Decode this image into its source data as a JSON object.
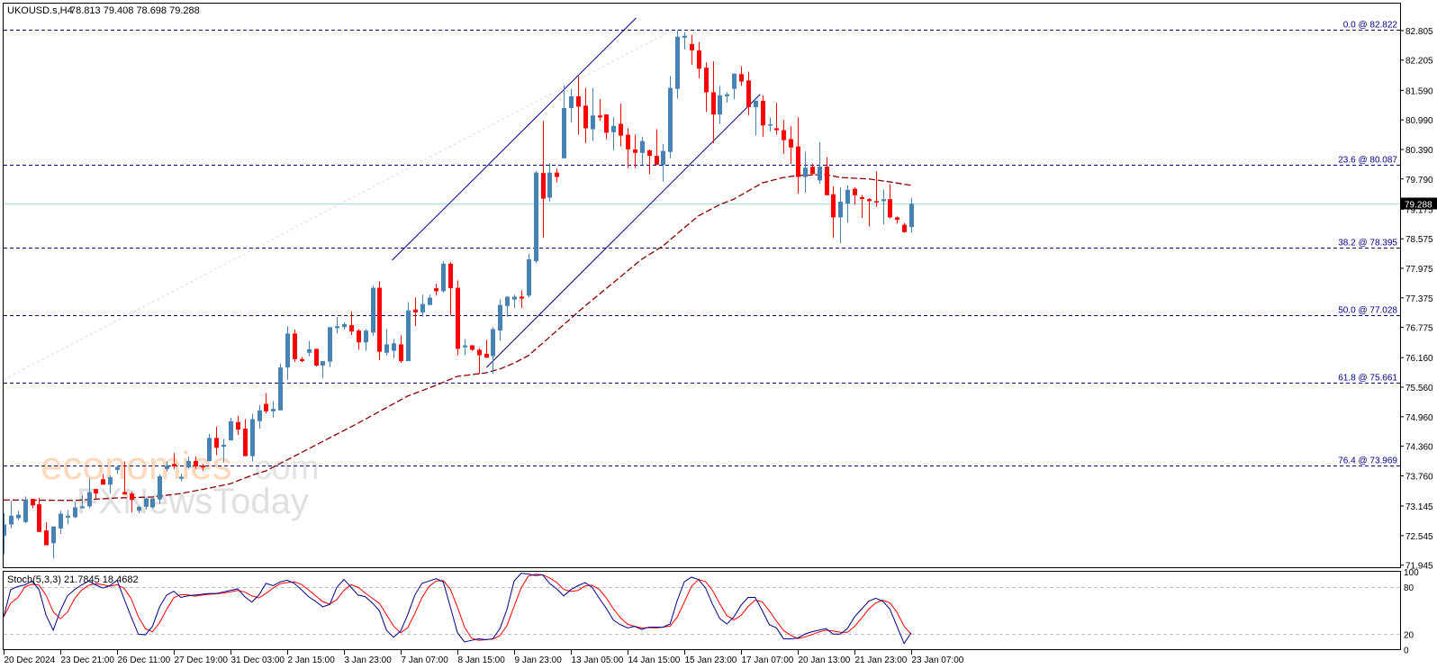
{
  "header": {
    "symbol": "UKOUSD.s,H4",
    "ohlc": "78.813 79.408 78.698 79.288"
  },
  "watermark": {
    "brand1": "economies",
    "brand1_suffix": ".com",
    "brand2": "FXNewsToday"
  },
  "colors": {
    "bull": "#4682b4",
    "bear": "#ff0000",
    "ma": "#8b0000",
    "fib": "#00008b",
    "trend": "#00008b",
    "price_line": "#9fe0e8",
    "stoch_k": "#00008b",
    "stoch_d": "#ff0000"
  },
  "chart_data": {
    "type": "candlestick",
    "title": "UKOUSD.s,H4",
    "ylim": [
      71.945,
      82.822
    ],
    "price_axis_ticks": [
      "82.805",
      "82.205",
      "81.590",
      "80.990",
      "80.390",
      "79.790",
      "79.175",
      "78.575",
      "77.975",
      "77.375",
      "76.775",
      "76.160",
      "75.560",
      "74.960",
      "74.360",
      "73.760",
      "73.145",
      "72.545",
      "71.945"
    ],
    "current_price": "79.288",
    "time_labels": [
      "20 Dec 2024",
      "23 Dec 21:00",
      "26 Dec 11:00",
      "27 Dec 19:00",
      "31 Dec 03:00",
      "2 Jan 15:00",
      "3 Jan 23:00",
      "7 Jan 07:00",
      "8 Jan 15:00",
      "9 Jan 23:00",
      "13 Jan 05:00",
      "14 Jan 15:00",
      "15 Jan 23:00",
      "17 Jan 07:00",
      "20 Jan 13:00",
      "21 Jan 23:00",
      "23 Jan 07:00"
    ],
    "bars_per_time_label": 8,
    "candles_ohlc": [
      [
        72.54,
        73.01,
        72.17,
        72.77
      ],
      [
        72.77,
        73.25,
        72.69,
        72.95
      ],
      [
        72.9,
        73.05,
        72.86,
        72.97
      ],
      [
        72.82,
        73.34,
        72.8,
        73.27
      ],
      [
        73.29,
        73.29,
        73.1,
        73.16
      ],
      [
        73.18,
        73.31,
        72.62,
        72.62
      ],
      [
        72.65,
        72.82,
        72.35,
        72.35
      ],
      [
        72.39,
        72.73,
        72.08,
        72.73
      ],
      [
        72.69,
        73.05,
        72.58,
        72.99
      ],
      [
        72.91,
        73.06,
        72.77,
        72.95
      ],
      [
        72.92,
        73.23,
        72.9,
        73.12
      ],
      [
        73.1,
        73.36,
        73.1,
        73.14
      ],
      [
        73.14,
        73.71,
        73.1,
        73.43
      ],
      [
        73.49,
        73.49,
        73.3,
        73.4
      ],
      [
        73.69,
        73.79,
        73.58,
        73.58
      ],
      [
        73.58,
        73.77,
        73.4,
        73.73
      ],
      [
        73.88,
        73.97,
        73.8,
        73.94
      ],
      [
        73.43,
        74.05,
        73.38,
        73.38
      ],
      [
        73.4,
        73.44,
        73.02,
        73.27
      ],
      [
        73.05,
        73.15,
        73.0,
        73.13
      ],
      [
        73.13,
        73.32,
        73.08,
        73.3
      ],
      [
        73.12,
        73.3,
        73.1,
        73.3
      ],
      [
        73.28,
        73.79,
        73.19,
        73.75
      ],
      [
        73.9,
        74.05,
        73.85,
        73.96
      ],
      [
        74.0,
        74.22,
        73.9,
        73.95
      ],
      [
        73.7,
        73.8,
        73.65,
        73.74
      ],
      [
        73.93,
        74.15,
        73.9,
        74.06
      ],
      [
        74.06,
        74.15,
        73.9,
        73.95
      ],
      [
        73.97,
        74.0,
        73.86,
        73.93
      ],
      [
        74.06,
        74.61,
        74.05,
        74.53
      ],
      [
        74.53,
        74.76,
        74.18,
        74.33
      ],
      [
        74.35,
        74.51,
        74.03,
        74.39
      ],
      [
        74.48,
        74.94,
        74.48,
        74.87
      ],
      [
        74.85,
        74.98,
        74.59,
        74.7
      ],
      [
        74.72,
        74.91,
        74.16,
        74.16
      ],
      [
        74.16,
        75.02,
        74.05,
        74.91
      ],
      [
        74.87,
        75.2,
        74.72,
        75.09
      ],
      [
        75.22,
        75.44,
        75.03,
        75.07
      ],
      [
        75.07,
        75.28,
        74.94,
        75.12
      ],
      [
        75.09,
        76.04,
        75.09,
        75.96
      ],
      [
        75.96,
        76.8,
        75.71,
        76.65
      ],
      [
        76.65,
        76.73,
        76.07,
        76.13
      ],
      [
        76.13,
        76.17,
        76.07,
        76.09
      ],
      [
        76.26,
        76.5,
        76.19,
        76.33
      ],
      [
        76.34,
        76.34,
        75.98,
        76.0
      ],
      [
        76.0,
        76.09,
        75.74,
        76.09
      ],
      [
        76.08,
        76.78,
        75.97,
        76.78
      ],
      [
        76.76,
        76.99,
        76.65,
        76.8
      ],
      [
        76.78,
        76.88,
        76.73,
        76.84
      ],
      [
        76.82,
        77.1,
        76.62,
        76.69
      ],
      [
        76.71,
        76.74,
        76.32,
        76.47
      ],
      [
        76.47,
        76.74,
        76.3,
        76.71
      ],
      [
        76.67,
        77.62,
        76.6,
        77.58
      ],
      [
        77.58,
        77.71,
        76.11,
        76.28
      ],
      [
        76.26,
        76.74,
        76.2,
        76.43
      ],
      [
        76.3,
        76.54,
        76.15,
        76.45
      ],
      [
        76.43,
        76.61,
        76.06,
        76.09
      ],
      [
        76.09,
        77.29,
        76.09,
        77.12
      ],
      [
        77.14,
        77.38,
        76.8,
        77.08
      ],
      [
        77.08,
        77.44,
        76.99,
        77.25
      ],
      [
        77.23,
        77.44,
        77.23,
        77.38
      ],
      [
        77.57,
        77.66,
        77.42,
        77.51
      ],
      [
        77.51,
        78.12,
        77.48,
        78.07
      ],
      [
        78.07,
        78.1,
        77.02,
        77.57
      ],
      [
        77.58,
        77.73,
        76.21,
        76.34
      ],
      [
        76.37,
        76.54,
        76.21,
        76.41
      ],
      [
        76.41,
        76.41,
        76.3,
        76.32
      ],
      [
        76.32,
        76.35,
        75.83,
        76.21
      ],
      [
        76.24,
        76.52,
        76.16,
        76.16
      ],
      [
        76.19,
        76.78,
        75.84,
        76.74
      ],
      [
        76.71,
        77.34,
        76.5,
        77.23
      ],
      [
        77.21,
        77.4,
        76.99,
        77.4
      ],
      [
        77.34,
        77.44,
        77.17,
        77.4
      ],
      [
        77.4,
        77.53,
        77.17,
        77.36
      ],
      [
        77.42,
        78.27,
        77.38,
        78.16
      ],
      [
        78.12,
        79.95,
        78.08,
        79.92
      ],
      [
        79.91,
        80.97,
        78.6,
        79.39
      ],
      [
        79.41,
        80.11,
        79.33,
        79.92
      ],
      [
        79.92,
        80.0,
        79.72,
        79.83
      ],
      [
        80.21,
        81.69,
        80.21,
        81.23
      ],
      [
        81.23,
        81.62,
        80.94,
        81.47
      ],
      [
        81.47,
        81.88,
        80.69,
        81.26
      ],
      [
        81.28,
        81.64,
        80.52,
        80.82
      ],
      [
        80.8,
        81.64,
        80.56,
        81.08
      ],
      [
        81.08,
        81.41,
        80.97,
        81.04
      ],
      [
        81.1,
        81.1,
        80.6,
        80.73
      ],
      [
        80.74,
        81.04,
        80.37,
        80.87
      ],
      [
        80.91,
        81.32,
        80.45,
        80.67
      ],
      [
        80.69,
        80.82,
        80.01,
        80.39
      ],
      [
        80.39,
        80.69,
        80.01,
        80.32
      ],
      [
        80.32,
        80.65,
        80.08,
        80.56
      ],
      [
        80.37,
        80.39,
        79.89,
        80.26
      ],
      [
        80.26,
        80.8,
        80.08,
        80.08
      ],
      [
        80.08,
        80.5,
        79.74,
        80.36
      ],
      [
        80.34,
        81.88,
        80.21,
        81.64
      ],
      [
        81.62,
        82.81,
        81.42,
        82.68
      ],
      [
        82.66,
        82.77,
        82.42,
        82.7
      ],
      [
        82.53,
        82.72,
        82.11,
        82.4
      ],
      [
        82.4,
        82.57,
        81.84,
        82.03
      ],
      [
        82.05,
        82.16,
        81.15,
        81.55
      ],
      [
        81.55,
        82.18,
        80.52,
        81.1
      ],
      [
        81.1,
        81.68,
        80.91,
        81.49
      ],
      [
        81.47,
        81.55,
        81.34,
        81.51
      ],
      [
        81.62,
        81.93,
        81.41,
        81.93
      ],
      [
        81.92,
        82.08,
        81.68,
        81.77
      ],
      [
        81.79,
        81.97,
        81.08,
        81.25
      ],
      [
        81.25,
        81.38,
        80.67,
        81.38
      ],
      [
        81.38,
        81.49,
        80.65,
        80.88
      ],
      [
        80.88,
        81.04,
        80.75,
        80.9
      ],
      [
        80.82,
        81.34,
        80.69,
        80.78
      ],
      [
        80.78,
        80.99,
        80.3,
        80.58
      ],
      [
        80.6,
        80.86,
        80.1,
        80.43
      ],
      [
        80.45,
        81.04,
        79.49,
        79.83
      ],
      [
        79.83,
        80.34,
        79.51,
        80.02
      ],
      [
        80.04,
        80.1,
        79.87,
        79.89
      ],
      [
        79.76,
        80.54,
        79.69,
        80.04
      ],
      [
        80.04,
        80.23,
        79.46,
        79.46
      ],
      [
        79.48,
        79.64,
        78.59,
        79.01
      ],
      [
        79.01,
        79.62,
        78.49,
        79.33
      ],
      [
        79.29,
        79.66,
        78.9,
        79.57
      ],
      [
        79.59,
        79.62,
        79.27,
        79.46
      ],
      [
        79.42,
        79.46,
        79.0,
        79.38
      ],
      [
        79.38,
        79.4,
        78.83,
        79.34
      ],
      [
        79.34,
        79.94,
        79.23,
        79.31
      ],
      [
        79.34,
        79.57,
        78.87,
        79.38
      ],
      [
        79.38,
        79.68,
        78.99,
        79.01
      ],
      [
        79.01,
        79.03,
        78.88,
        78.96
      ],
      [
        78.86,
        78.9,
        78.7,
        78.71
      ],
      [
        78.813,
        79.408,
        78.698,
        79.288
      ]
    ],
    "moving_average_points": [
      [
        0,
        73.27
      ],
      [
        10,
        73.26
      ],
      [
        16,
        73.31
      ],
      [
        21,
        73.33
      ],
      [
        25,
        73.4
      ],
      [
        29,
        73.51
      ],
      [
        32,
        73.6
      ],
      [
        35,
        73.77
      ],
      [
        37,
        73.86
      ],
      [
        50,
        74.83
      ],
      [
        57,
        75.38
      ],
      [
        61,
        75.6
      ],
      [
        64,
        75.78
      ],
      [
        68,
        75.85
      ],
      [
        70,
        75.93
      ],
      [
        72,
        76.05
      ],
      [
        74,
        76.2
      ],
      [
        82,
        77.21
      ],
      [
        90,
        78.16
      ],
      [
        93,
        78.43
      ],
      [
        96,
        78.8
      ],
      [
        98,
        79.04
      ],
      [
        101,
        79.27
      ],
      [
        103,
        79.38
      ],
      [
        107,
        79.71
      ],
      [
        110,
        79.82
      ],
      [
        112,
        79.86
      ],
      [
        116,
        79.88
      ],
      [
        118,
        79.82
      ],
      [
        122,
        79.79
      ],
      [
        125,
        79.73
      ],
      [
        128,
        79.66
      ]
    ],
    "fibonacci": [
      {
        "label": "0.0 @ 82.822",
        "price": 82.822
      },
      {
        "label": "23.6 @ 80.087",
        "price": 80.087
      },
      {
        "label": "38.2 @ 78.395",
        "price": 78.395
      },
      {
        "label": "50.0 @ 77.028",
        "price": 77.028
      },
      {
        "label": "61.8 @ 75.661",
        "price": 75.661
      },
      {
        "label": "76.4 @ 73.969",
        "price": 73.969
      }
    ],
    "fib_base_line": [
      [
        0,
        75.71
      ],
      [
        94.5,
        82.822
      ]
    ],
    "trendlines": [
      {
        "name": "channel-lower",
        "points": [
          [
            68.1,
            75.96
          ],
          [
            106.7,
            81.51
          ]
        ]
      },
      {
        "name": "channel-upper",
        "points": [
          [
            54.8,
            78.14
          ],
          [
            89.2,
            83.06
          ]
        ]
      }
    ],
    "stochastic": {
      "label": "Stoch(5,3,3) 21.7845 18.4682",
      "levels": [
        "100",
        "80",
        "20",
        "0"
      ],
      "dashed_levels": [
        80,
        20
      ],
      "d_period": 3,
      "k": [
        42,
        77,
        81,
        83,
        88,
        77,
        44,
        25,
        50,
        69,
        77,
        83,
        88,
        83,
        79,
        82,
        89,
        65,
        42,
        20,
        19,
        30,
        55,
        70,
        75,
        67,
        69,
        70,
        71,
        72,
        72,
        74,
        76,
        78,
        68,
        61,
        70,
        85,
        82,
        87,
        89,
        85,
        77,
        68,
        62,
        55,
        58,
        80,
        90,
        80,
        70,
        68,
        60,
        50,
        25,
        16,
        24,
        45,
        70,
        85,
        88,
        91,
        87,
        55,
        22,
        10,
        12,
        14,
        13,
        14,
        27,
        52,
        88,
        98,
        97,
        95,
        96,
        85,
        78,
        69,
        77,
        82,
        86,
        80,
        66,
        53,
        38,
        32,
        28,
        30,
        26,
        29,
        29,
        29,
        33,
        63,
        87,
        93,
        90,
        79,
        58,
        40,
        33,
        42,
        57,
        67,
        67,
        50,
        32,
        28,
        14,
        14,
        15,
        20,
        23,
        25,
        27,
        20,
        20,
        27,
        42,
        52,
        62,
        66,
        62,
        52,
        30,
        8,
        21.7845
      ]
    }
  }
}
